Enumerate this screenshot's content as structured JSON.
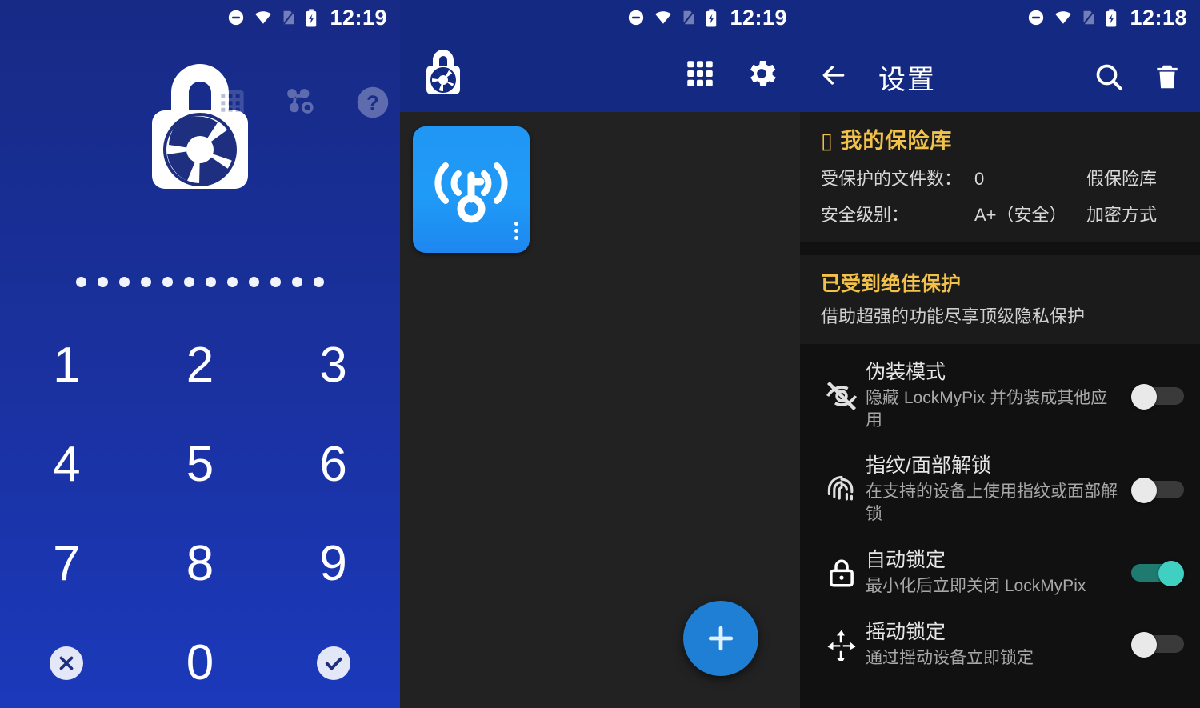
{
  "lock_screen": {
    "status_bar": {
      "time": "12:19",
      "icons": [
        "dnd-icon",
        "wifi-icon",
        "sim-off-icon",
        "battery-charging-icon"
      ]
    },
    "logo_name": "lockmypix-logo",
    "top_icons": [
      {
        "name": "keypad-icon",
        "label": "Keypad"
      },
      {
        "name": "share-nodes-icon",
        "label": "Share"
      },
      {
        "name": "help-icon",
        "label": "Help"
      }
    ],
    "pin_dots": 12,
    "keypad": [
      {
        "label": "1",
        "name": "key-1"
      },
      {
        "label": "2",
        "name": "key-2"
      },
      {
        "label": "3",
        "name": "key-3"
      },
      {
        "label": "4",
        "name": "key-4"
      },
      {
        "label": "5",
        "name": "key-5"
      },
      {
        "label": "6",
        "name": "key-6"
      },
      {
        "label": "7",
        "name": "key-7"
      },
      {
        "label": "8",
        "name": "key-8"
      },
      {
        "label": "9",
        "name": "key-9"
      },
      {
        "label": "",
        "name": "key-clear"
      },
      {
        "label": "0",
        "name": "key-0"
      },
      {
        "label": "",
        "name": "key-confirm"
      }
    ]
  },
  "gallery_screen": {
    "status_bar": {
      "time": "12:19"
    },
    "appbar": {
      "logo_name": "lockmypix-lock-camera-logo",
      "actions": [
        {
          "name": "grid-view-icon",
          "label": "Grid"
        },
        {
          "name": "settings-gear-icon",
          "label": "Settings"
        }
      ]
    },
    "tiles": [
      {
        "name": "album-tile-wifi",
        "icon": "wifi-key-icon",
        "color": "#1f93f5"
      }
    ],
    "fab": {
      "name": "add-button",
      "label": "+",
      "color": "#1e7fd4"
    }
  },
  "settings_screen": {
    "status_bar": {
      "time": "12:18"
    },
    "appbar": {
      "back_label": "←",
      "title": "设置",
      "actions": [
        {
          "name": "search-icon",
          "label": "搜索"
        },
        {
          "name": "delete-icon",
          "label": "删除"
        }
      ]
    },
    "vault_card": {
      "title": "我的保险库",
      "title_prefix_glyph": "▯",
      "rows": [
        {
          "key": "受保护的文件数：",
          "value": "0",
          "action": "假保险库"
        },
        {
          "key": "安全级别：",
          "value": "A+（安全）",
          "action": "加密方式"
        }
      ]
    },
    "protection_card": {
      "title": "已受到绝佳保护",
      "subtitle": "借助超强的功能尽享顶级隐私保护"
    },
    "options": [
      {
        "icon": "eye-off-icon",
        "title": "伪装模式",
        "subtitle": "隐藏 LockMyPix 并伪装成其他应用",
        "toggle": "off"
      },
      {
        "icon": "fingerprint-icon",
        "title": "指纹/面部解锁",
        "subtitle": "在支持的设备上使用指纹或面部解锁",
        "toggle": "off"
      },
      {
        "icon": "lock-icon",
        "title": "自动锁定",
        "subtitle": "最小化后立即关闭 LockMyPix",
        "toggle": "on"
      },
      {
        "icon": "shake-icon",
        "title": "摇动锁定",
        "subtitle": "通过摇动设备立即锁定",
        "toggle": "off"
      }
    ],
    "colors": {
      "accent_gold": "#f2c14a",
      "toggle_on": "#3fd0c2",
      "appbar_blue": "#142a82"
    }
  }
}
